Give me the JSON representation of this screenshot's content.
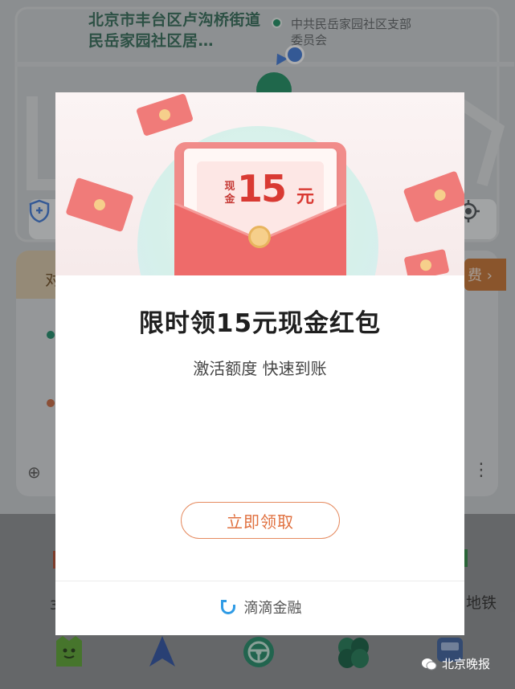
{
  "map": {
    "label_main": "北京市丰台区卢沟桥街道民岳家园社区居…",
    "label_side": "中共民岳家园社区支部委员会"
  },
  "background_panel": {
    "strip_text": "对",
    "fee_text": "费 ›",
    "subway_text": "地铁",
    "left_small_text": "3"
  },
  "tabbar": {
    "icons": [
      "taxi-icon",
      "navigation-icon",
      "steering-wheel-icon",
      "bike-icon",
      "bus-icon"
    ]
  },
  "watermark": {
    "text": "北京晚报"
  },
  "modal": {
    "card_label": "现金",
    "card_amount": "15",
    "card_unit": "元",
    "title": "限时领15元现金红包",
    "subtitle": "激活额度 快速到账",
    "claim_button": "立即领取",
    "brand_name": "滴滴金融"
  },
  "colors": {
    "accent_orange": "#e0703f",
    "envelope_red": "#f18c8a",
    "brand_blue": "#2f9be5"
  }
}
